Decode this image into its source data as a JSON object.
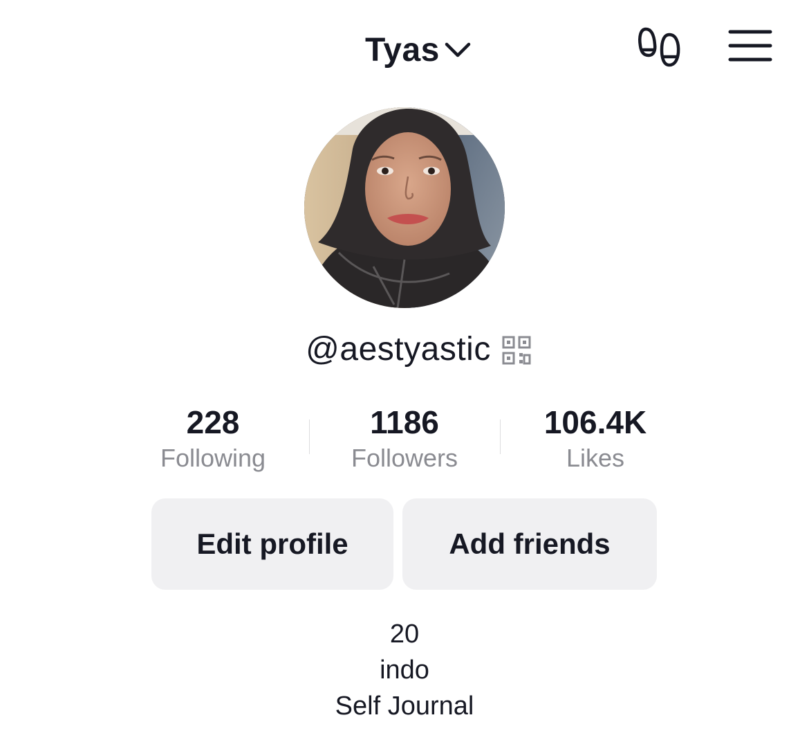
{
  "header": {
    "account_name": "Tyas",
    "icons": {
      "switcher": "chevron-down-icon",
      "footprints": "footprint-icon",
      "menu": "hamburger-menu-icon"
    }
  },
  "profile": {
    "avatar_icon": "avatar",
    "username": "@aestyastic",
    "qr_icon": "qr-code-icon"
  },
  "stats": [
    {
      "value": "228",
      "label": "Following"
    },
    {
      "value": "1186",
      "label": "Followers"
    },
    {
      "value": "106.4K",
      "label": "Likes"
    }
  ],
  "actions": {
    "edit_profile": "Edit profile",
    "add_friends": "Add friends"
  },
  "bio": {
    "lines": [
      "20",
      "indo",
      "Self Journal"
    ]
  },
  "colors": {
    "text_primary": "#161823",
    "text_secondary": "#8a8b91",
    "button_bg": "#f0f0f2",
    "background": "#ffffff"
  }
}
